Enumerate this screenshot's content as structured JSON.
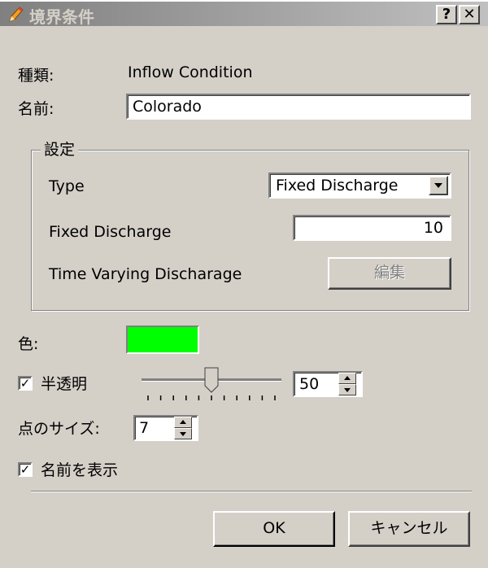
{
  "window": {
    "title": "境界条件",
    "help_label": "?",
    "close_label": "✕"
  },
  "kind": {
    "label": "種類:",
    "value": "Inflow Condition"
  },
  "name": {
    "label": "名前:",
    "value": "Colorado"
  },
  "settings": {
    "legend": "設定",
    "type_label": "Type",
    "type_value": "Fixed Discharge",
    "fixed_label": "Fixed Discharge",
    "fixed_value": "10",
    "time_label": "Time Varying Discharage",
    "edit_label": "編集"
  },
  "color": {
    "label": "色:",
    "swatch": "#00ff00"
  },
  "transparency": {
    "checkbox_label": "半透明",
    "checked": true,
    "slider_value": 50,
    "spin_value": "50"
  },
  "point_size": {
    "label": "点のサイズ:",
    "value": "7"
  },
  "show_name": {
    "label": "名前を表示",
    "checked": true
  },
  "buttons": {
    "ok": "OK",
    "cancel": "キャンセル"
  }
}
